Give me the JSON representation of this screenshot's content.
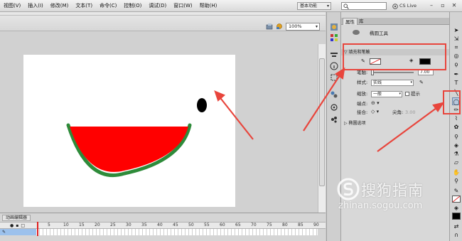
{
  "menubar": {
    "items": [
      "视图(V)",
      "插入(I)",
      "修改(M)",
      "文本(T)",
      "命令(C)",
      "控制(O)",
      "调试(D)",
      "窗口(W)",
      "帮助(H)"
    ],
    "workspace": "基本功能",
    "search_placeholder": "",
    "cs_live": "CS Live"
  },
  "doc_toolbar": {
    "zoom": "100%"
  },
  "timeline": {
    "tab_label": "动画编辑器",
    "frame_numbers": [
      "5",
      "10",
      "15",
      "20",
      "25",
      "30",
      "35",
      "40",
      "45",
      "50",
      "55",
      "60",
      "65",
      "70",
      "75",
      "80",
      "85",
      "90"
    ]
  },
  "properties": {
    "tabs": [
      "属性",
      "库"
    ],
    "tool_name": "椭圆工具",
    "fill_stroke_header": "填充和笔触",
    "stroke_label": "笔触:",
    "stroke_value": "7.00",
    "style_label": "样式:",
    "style_value": "实线",
    "scale_label": "缩放:",
    "scale_value": "一般",
    "hint_label": "提示",
    "cap_label": "端点:",
    "join_label": "接合:",
    "miter_label": "尖角:",
    "miter_value": "3.00",
    "oval_options_header": "椭圆选项",
    "stroke_color": "#e0e0e0",
    "fill_color": "#000000"
  },
  "stage_content": {
    "watermelon_red": "#ff0000",
    "watermelon_rind": "#2e8b3a",
    "eye_color": "#000000"
  },
  "watermark": {
    "text": "搜狗指南",
    "url": "zhinan.sogou.com"
  },
  "colors": {
    "annotation_red": "#e8453c"
  }
}
